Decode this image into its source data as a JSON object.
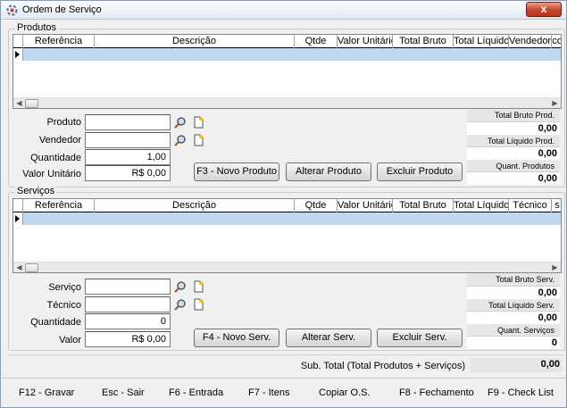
{
  "window": {
    "title": "Ordem de Serviço",
    "close_label": "x"
  },
  "produtos": {
    "group_label": "Produtos",
    "columns": [
      "Referência",
      "Descrição",
      "Qtde",
      "Valor Unitário",
      "Total Bruto",
      "Total Líquido",
      "Vendedor",
      "co"
    ],
    "form": {
      "produto_label": "Produto",
      "vendedor_label": "Vendedor",
      "quantidade_label": "Quantidade",
      "quantidade_value": "1,00",
      "valor_label": "Valor Unitário",
      "valor_value": "R$ 0,00"
    },
    "buttons": {
      "novo": "F3 - Novo Produto",
      "alterar": "Alterar Produto",
      "excluir": "Excluir Produto"
    },
    "totals": {
      "bruto_label": "Total Bruto Prod.",
      "bruto_value": "0,00",
      "liquido_label": "Total Líquido Prod.",
      "liquido_value": "0,00",
      "quant_label": "Quant. Produtos",
      "quant_value": "0,00"
    }
  },
  "servicos": {
    "group_label": "Serviços",
    "columns": [
      "Referência",
      "Descrição",
      "Qtde",
      "Valor Unitário",
      "Total Bruto",
      "Total Líquido",
      "Técnico",
      "s"
    ],
    "form": {
      "servico_label": "Serviço",
      "tecnico_label": "Técnico",
      "quantidade_label": "Quantidade",
      "quantidade_value": "0",
      "valor_label": "Valor",
      "valor_value": "R$ 0,00"
    },
    "buttons": {
      "novo": "F4 - Novo Serv.",
      "alterar": "Alterar Serv.",
      "excluir": "Excluir Serv."
    },
    "totals": {
      "bruto_label": "Total Bruto Serv.",
      "bruto_value": "0,00",
      "liquido_label": "Total Líquido Serv.",
      "liquido_value": "0,00",
      "quant_label": "Quant. Serviços",
      "quant_value": "0"
    }
  },
  "subtotal": {
    "label": "Sub. Total (Total Produtos + Serviços)",
    "value": "0,00"
  },
  "shortcuts": [
    "F12 - Gravar",
    "Esc - Sair",
    "F6 - Entrada",
    "F7 - Itens",
    "Copiar O.S.",
    "F8 - Fechamento",
    "F9 - Check List"
  ]
}
